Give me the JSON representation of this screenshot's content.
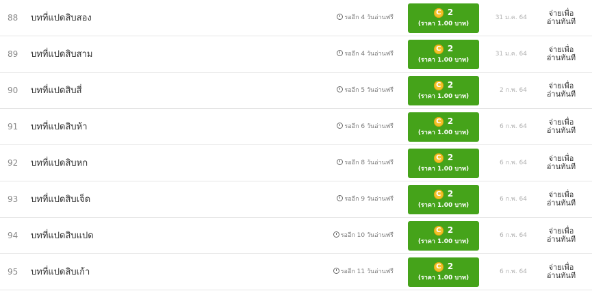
{
  "colors": {
    "buy_button": "#45a31a",
    "coin": "#f4c12a"
  },
  "icons": {
    "wait": "clock-icon",
    "coin": "coin-icon"
  },
  "rows": [
    {
      "num": "88",
      "title": "บทที่แปดสิบสอง",
      "wait": "รออีก 4 วันอ่านฟรี",
      "coin_symbol": "C",
      "coins": "2",
      "price": "(ราคา 1.00 บาท)",
      "date": "31 ม.ค. 64",
      "pay_line1": "จ่ายเพื่อ",
      "pay_line2": "อ่านทันที"
    },
    {
      "num": "89",
      "title": "บทที่แปดสิบสาม",
      "wait": "รออีก 4 วันอ่านฟรี",
      "coin_symbol": "C",
      "coins": "2",
      "price": "(ราคา 1.00 บาท)",
      "date": "31 ม.ค. 64",
      "pay_line1": "จ่ายเพื่อ",
      "pay_line2": "อ่านทันที"
    },
    {
      "num": "90",
      "title": "บทที่แปดสิบสี่",
      "wait": "รออีก 5 วันอ่านฟรี",
      "coin_symbol": "C",
      "coins": "2",
      "price": "(ราคา 1.00 บาท)",
      "date": "2 ก.พ. 64",
      "pay_line1": "จ่ายเพื่อ",
      "pay_line2": "อ่านทันที"
    },
    {
      "num": "91",
      "title": "บทที่แปดสิบห้า",
      "wait": "รออีก 6 วันอ่านฟรี",
      "coin_symbol": "C",
      "coins": "2",
      "price": "(ราคา 1.00 บาท)",
      "date": "6 ก.พ. 64",
      "pay_line1": "จ่ายเพื่อ",
      "pay_line2": "อ่านทันที"
    },
    {
      "num": "92",
      "title": "บทที่แปดสิบหก",
      "wait": "รออีก 8 วันอ่านฟรี",
      "coin_symbol": "C",
      "coins": "2",
      "price": "(ราคา 1.00 บาท)",
      "date": "6 ก.พ. 64",
      "pay_line1": "จ่ายเพื่อ",
      "pay_line2": "อ่านทันที"
    },
    {
      "num": "93",
      "title": "บทที่แปดสิบเจ็ด",
      "wait": "รออีก 9 วันอ่านฟรี",
      "coin_symbol": "C",
      "coins": "2",
      "price": "(ราคา 1.00 บาท)",
      "date": "6 ก.พ. 64",
      "pay_line1": "จ่ายเพื่อ",
      "pay_line2": "อ่านทันที"
    },
    {
      "num": "94",
      "title": "บทที่แปดสิบแปด",
      "wait": "รออีก 10 วันอ่านฟรี",
      "coin_symbol": "C",
      "coins": "2",
      "price": "(ราคา 1.00 บาท)",
      "date": "6 ก.พ. 64",
      "pay_line1": "จ่ายเพื่อ",
      "pay_line2": "อ่านทันที"
    },
    {
      "num": "95",
      "title": "บทที่แปดสิบเก้า",
      "wait": "รออีก 11 วันอ่านฟรี",
      "coin_symbol": "C",
      "coins": "2",
      "price": "(ราคา 1.00 บาท)",
      "date": "6 ก.พ. 64",
      "pay_line1": "จ่ายเพื่อ",
      "pay_line2": "อ่านทันที"
    }
  ]
}
